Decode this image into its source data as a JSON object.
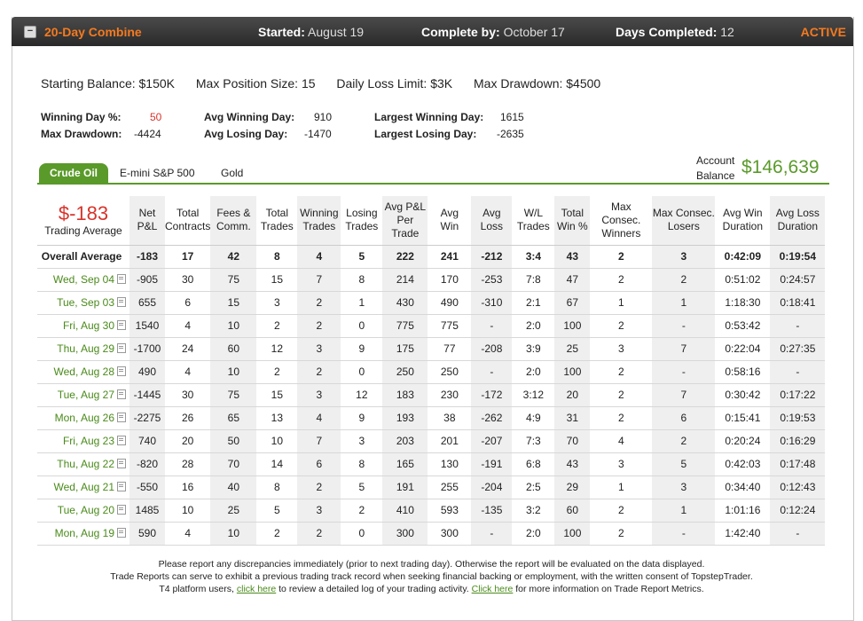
{
  "header": {
    "title": "20-Day Combine",
    "started_label": "Started",
    "started_value": "August 19",
    "complete_label": "Complete by",
    "complete_value": "October 17",
    "days_label": "Days Completed",
    "days_value": "12",
    "status": "ACTIVE"
  },
  "summary": {
    "starting_balance": "Starting Balance: $150K",
    "max_position": "Max Position Size: 15",
    "daily_loss": "Daily Loss Limit: $3K",
    "max_drawdown": "Max Drawdown: $4500"
  },
  "stats": {
    "winning_day_pct_label": "Winning Day %:",
    "winning_day_pct": "50",
    "max_drawdown_label": "Max Drawdown:",
    "max_drawdown": "-4424",
    "avg_winning_day_label": "Avg Winning Day:",
    "avg_winning_day": "910",
    "avg_losing_day_label": "Avg Losing Day:",
    "avg_losing_day": "-1470",
    "largest_winning_day_label": "Largest Winning Day:",
    "largest_winning_day": "1615",
    "largest_losing_day_label": "Largest Losing Day:",
    "largest_losing_day": "-2635"
  },
  "tabs": [
    "Crude Oil",
    "E-mini S&P 500",
    "Gold"
  ],
  "account": {
    "label_line1": "Account",
    "label_line2": "Balance",
    "value": "$146,639"
  },
  "table": {
    "trading_average_value": "$-183",
    "trading_average_label": "Trading Average",
    "headers": [
      [
        "Net",
        "P&L"
      ],
      [
        "Total",
        "Contracts"
      ],
      [
        "Fees &",
        "Comm."
      ],
      [
        "Total",
        "Trades"
      ],
      [
        "Winning",
        "Trades"
      ],
      [
        "Losing",
        "Trades"
      ],
      [
        "Avg P&L",
        "Per",
        "Trade"
      ],
      [
        "Avg",
        "Win"
      ],
      [
        "Avg",
        "Loss"
      ],
      [
        "W/L",
        "Trades"
      ],
      [
        "Total",
        "Win %"
      ],
      [
        "Max Consec.",
        "Winners"
      ],
      [
        "Max Consec.",
        "Losers"
      ],
      [
        "Avg Win",
        "Duration"
      ],
      [
        "Avg Loss",
        "Duration"
      ]
    ],
    "overall": {
      "label": "Overall Average",
      "cells": [
        "-183",
        "17",
        "42",
        "8",
        "4",
        "5",
        "222",
        "241",
        "-212",
        "3:4",
        "43",
        "2",
        "3",
        "0:42:09",
        "0:19:54"
      ]
    },
    "rows": [
      {
        "date": "Wed, Sep 04",
        "cells": [
          "-905",
          "30",
          "75",
          "15",
          "7",
          "8",
          "214",
          "170",
          "-253",
          "7:8",
          "47",
          "2",
          "2",
          "0:51:02",
          "0:24:57"
        ]
      },
      {
        "date": "Tue, Sep 03",
        "cells": [
          "655",
          "6",
          "15",
          "3",
          "2",
          "1",
          "430",
          "490",
          "-310",
          "2:1",
          "67",
          "1",
          "1",
          "1:18:30",
          "0:18:41"
        ]
      },
      {
        "date": "Fri, Aug 30",
        "cells": [
          "1540",
          "4",
          "10",
          "2",
          "2",
          "0",
          "775",
          "775",
          "-",
          "2:0",
          "100",
          "2",
          "-",
          "0:53:42",
          "-"
        ]
      },
      {
        "date": "Thu, Aug 29",
        "cells": [
          "-1700",
          "24",
          "60",
          "12",
          "3",
          "9",
          "175",
          "77",
          "-208",
          "3:9",
          "25",
          "3",
          "7",
          "0:22:04",
          "0:27:35"
        ]
      },
      {
        "date": "Wed, Aug 28",
        "cells": [
          "490",
          "4",
          "10",
          "2",
          "2",
          "0",
          "250",
          "250",
          "-",
          "2:0",
          "100",
          "2",
          "-",
          "0:58:16",
          "-"
        ]
      },
      {
        "date": "Tue, Aug 27",
        "cells": [
          "-1445",
          "30",
          "75",
          "15",
          "3",
          "12",
          "183",
          "230",
          "-172",
          "3:12",
          "20",
          "2",
          "7",
          "0:30:42",
          "0:17:22"
        ]
      },
      {
        "date": "Mon, Aug 26",
        "cells": [
          "-2275",
          "26",
          "65",
          "13",
          "4",
          "9",
          "193",
          "38",
          "-262",
          "4:9",
          "31",
          "2",
          "6",
          "0:15:41",
          "0:19:53"
        ]
      },
      {
        "date": "Fri, Aug 23",
        "cells": [
          "740",
          "20",
          "50",
          "10",
          "7",
          "3",
          "203",
          "201",
          "-207",
          "7:3",
          "70",
          "4",
          "2",
          "0:20:24",
          "0:16:29"
        ]
      },
      {
        "date": "Thu, Aug 22",
        "cells": [
          "-820",
          "28",
          "70",
          "14",
          "6",
          "8",
          "165",
          "130",
          "-191",
          "6:8",
          "43",
          "3",
          "5",
          "0:42:03",
          "0:17:48"
        ]
      },
      {
        "date": "Wed, Aug 21",
        "cells": [
          "-550",
          "16",
          "40",
          "8",
          "2",
          "5",
          "191",
          "255",
          "-204",
          "2:5",
          "29",
          "1",
          "3",
          "0:34:40",
          "0:12:43"
        ]
      },
      {
        "date": "Tue, Aug 20",
        "cells": [
          "1485",
          "10",
          "25",
          "5",
          "3",
          "2",
          "410",
          "593",
          "-135",
          "3:2",
          "60",
          "2",
          "1",
          "1:01:16",
          "0:12:24"
        ]
      },
      {
        "date": "Mon, Aug 19",
        "cells": [
          "590",
          "4",
          "10",
          "2",
          "2",
          "0",
          "300",
          "300",
          "-",
          "2:0",
          "100",
          "2",
          "-",
          "1:42:40",
          "-"
        ]
      }
    ]
  },
  "footer": {
    "line1": "Please report any discrepancies immediately (prior to next trading day). Otherwise the report will be evaluated on the data displayed.",
    "line2": "Trade Reports can serve to exhibit a previous trading track record when seeking financial backing or employment, with the written consent of TopstepTrader.",
    "line3_pre": "T4 platform users,",
    "link1": "click here",
    "line3_mid": "to review a detailed log of your trading activity.",
    "link2": "Click here",
    "line3_post": "for more information on Trade Report Metrics."
  },
  "colors": {
    "accent_orange": "#f47a20",
    "green": "#5a9a2a",
    "red": "#d8332a"
  }
}
